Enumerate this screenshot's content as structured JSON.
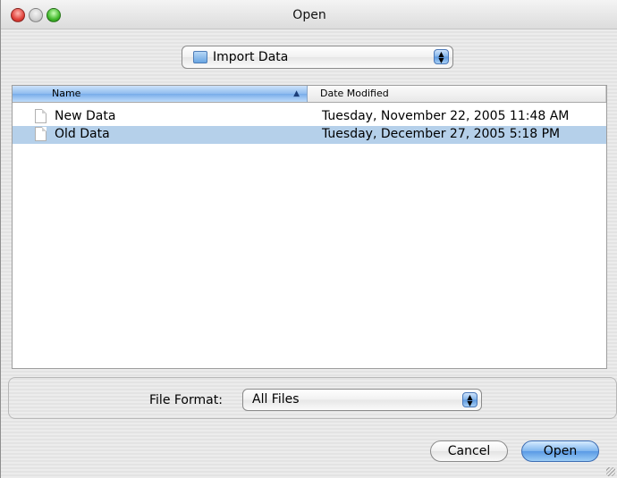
{
  "window": {
    "title": "Open"
  },
  "location": {
    "folder": "Import Data"
  },
  "browser": {
    "columns": {
      "name": "Name",
      "date": "Date Modified"
    },
    "rows": [
      {
        "name": "New Data",
        "date": "Tuesday, November 22, 2005 11:48 AM",
        "selected": false
      },
      {
        "name": "Old Data",
        "date": "Tuesday, December 27, 2005 5:18 PM",
        "selected": true
      }
    ]
  },
  "format": {
    "label": "File Format:",
    "value": "All Files"
  },
  "buttons": {
    "cancel": "Cancel",
    "open": "Open"
  },
  "colors": {
    "selection": "#b5d0ea",
    "accent": "#5a9ae5"
  }
}
